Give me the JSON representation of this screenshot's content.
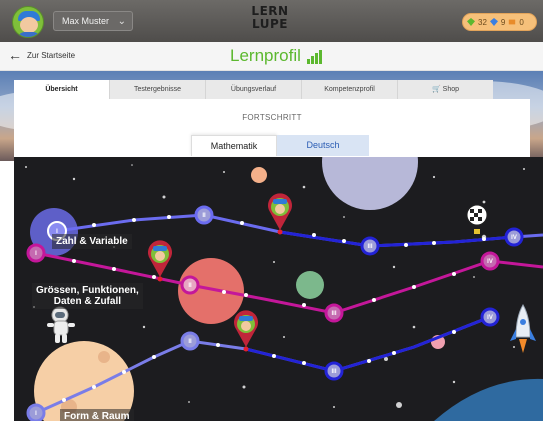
{
  "header": {
    "user_name": "Max Muster",
    "logo_line1": "LERN",
    "logo_line2": "LUPE",
    "counters": {
      "green": "32",
      "blue": "9",
      "orange": "0"
    }
  },
  "nav": {
    "back_label": "Zur Startseite",
    "title": "Lernprofil"
  },
  "tabs": [
    {
      "label": "Übersicht",
      "active": true
    },
    {
      "label": "Testergebnisse"
    },
    {
      "label": "Übungsverlauf"
    },
    {
      "label": "Kompetenzprofil"
    },
    {
      "label": "Shop"
    }
  ],
  "section_title": "FORTSCHRITT",
  "subjects": {
    "active": "Mathematik",
    "other": "Deutsch"
  },
  "paths": [
    {
      "name": "Zahl & Variable",
      "color": "#6b6cf0",
      "levels": [
        "I",
        "II",
        "III",
        "IV"
      ]
    },
    {
      "name": "Grössen, Funktionen, Daten & Zufall",
      "color": "#c4179a",
      "levels": [
        "I",
        "II",
        "III",
        "IV"
      ]
    },
    {
      "name": "Form & Raum",
      "color": "#7a7de8",
      "levels": [
        "I",
        "II",
        "III",
        "IV"
      ]
    }
  ],
  "labels": {
    "zahl": "Zahl & Variable",
    "groessen1": "Grössen, Funktionen,",
    "groessen2": "Daten & Zufall",
    "form": "Form & Raum"
  },
  "colors": {
    "accent_green": "#5cb82f",
    "path_blue": "#2323d6",
    "path_magenta": "#c4179a"
  }
}
